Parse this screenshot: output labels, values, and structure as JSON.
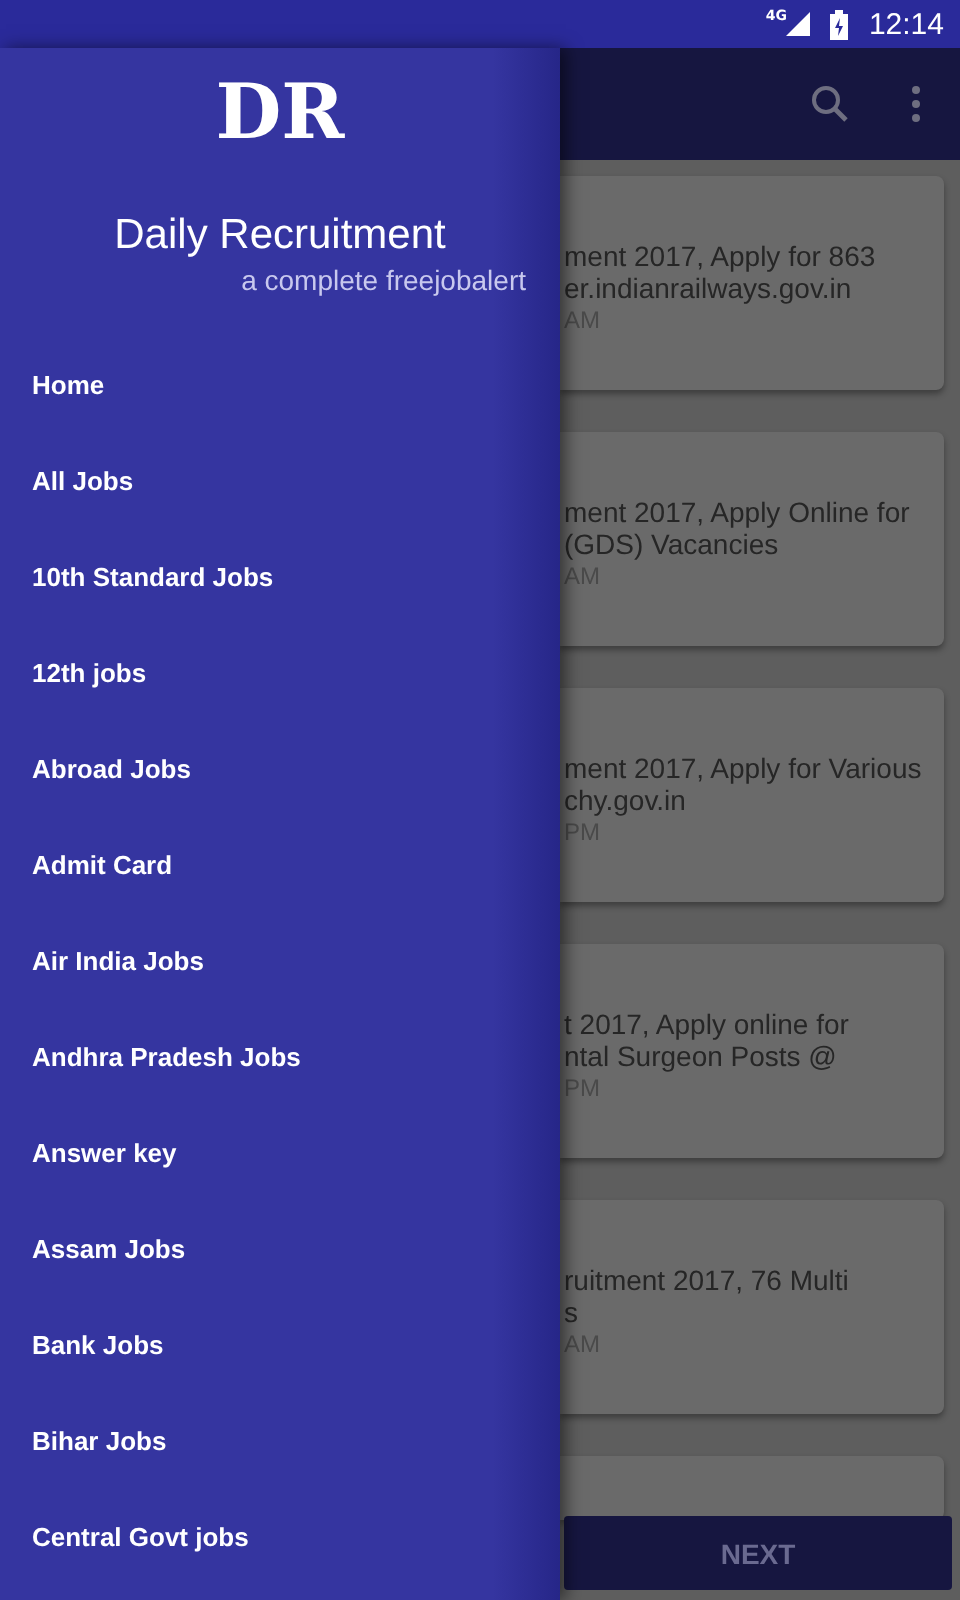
{
  "status_bar": {
    "network": "4G",
    "time": "12:14"
  },
  "drawer": {
    "logo": "DR",
    "title": "Daily Recruitment",
    "subtitle": "a complete freejobalert",
    "items": [
      "Home",
      "All Jobs",
      "10th Standard Jobs",
      "12th jobs",
      "Abroad Jobs",
      "Admit Card",
      "Air India Jobs",
      "Andhra Pradesh Jobs",
      "Answer key",
      "Assam Jobs",
      "Bank Jobs",
      "Bihar Jobs",
      "Central Govt jobs"
    ]
  },
  "cards": [
    {
      "lines": [
        "ment 2017, Apply for 863",
        "er.indianrailways.gov.in"
      ],
      "time": "AM"
    },
    {
      "lines": [
        "ment 2017, Apply Online for",
        "(GDS) Vacancies"
      ],
      "time": "AM"
    },
    {
      "lines": [
        "ment 2017, Apply for Various",
        "chy.gov.in"
      ],
      "time": "PM"
    },
    {
      "lines": [
        "t 2017, Apply online for",
        "ntal Surgeon Posts @"
      ],
      "time": "PM"
    },
    {
      "lines": [
        "ruitment 2017, 76 Multi",
        "s"
      ],
      "time": "AM"
    }
  ],
  "next_button": "NEXT"
}
